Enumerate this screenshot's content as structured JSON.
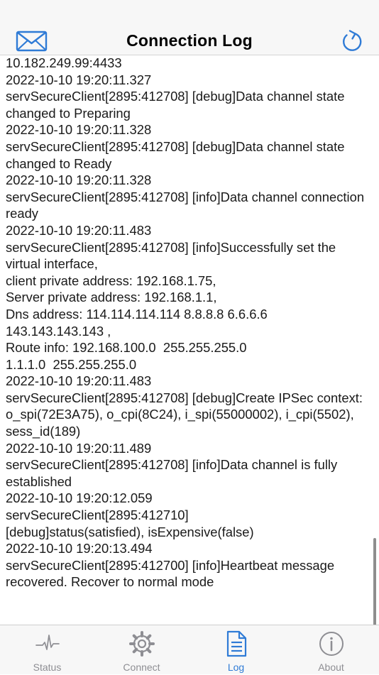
{
  "header": {
    "title": "Connection Log",
    "left_icon": "envelope-icon",
    "right_icon": "refresh-icon",
    "accent_color": "#2f7bd6"
  },
  "log": {
    "lines": [
      "10.182.249.99:4433",
      "2022-10-10 19:20:11.327",
      "servSecureClient[2895:412708] [debug]Data channel state changed to Preparing",
      "2022-10-10 19:20:11.328",
      "servSecureClient[2895:412708] [debug]Data channel state changed to Ready",
      "2022-10-10 19:20:11.328",
      "servSecureClient[2895:412708] [info]Data channel connection ready",
      "2022-10-10 19:20:11.483",
      "servSecureClient[2895:412708] [info]Successfully set the virtual interface,",
      "client private address: 192.168.1.75,",
      "Server private address: 192.168.1.1,",
      "Dns address: 114.114.114.114 8.8.8.8 6.6.6.6 143.143.143.143 ,",
      "Route info: 192.168.100.0  255.255.255.0",
      "1.1.1.0  255.255.255.0",
      "2022-10-10 19:20:11.483",
      "servSecureClient[2895:412708] [debug]Create IPSec context: o_spi(72E3A75), o_cpi(8C24), i_spi(55000002), i_cpi(5502), sess_id(189)",
      "2022-10-10 19:20:11.489",
      "servSecureClient[2895:412708] [info]Data channel is fully established",
      "2022-10-10 19:20:12.059",
      "servSecureClient[2895:412710]",
      "[debug]status(satisfied), isExpensive(false)",
      "2022-10-10 19:20:13.494",
      "servSecureClient[2895:412700] [info]Heartbeat message recovered. Recover to normal mode"
    ]
  },
  "tabs": [
    {
      "label": "Status",
      "icon": "heartbeat-icon",
      "active": false
    },
    {
      "label": "Connect",
      "icon": "gear-icon",
      "active": false
    },
    {
      "label": "Log",
      "icon": "document-icon",
      "active": true
    },
    {
      "label": "About",
      "icon": "info-icon",
      "active": false
    }
  ]
}
